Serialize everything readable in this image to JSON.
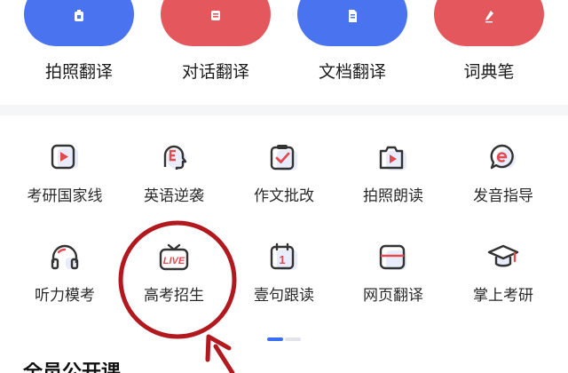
{
  "colors": {
    "blue": "#4a74ef",
    "red": "#e4585d",
    "icon_red": "#e24a4f",
    "annotation": "#b1191f"
  },
  "top_actions": [
    {
      "label": "拍照翻译",
      "color": "blue",
      "icon": "camera-icon"
    },
    {
      "label": "对话翻译",
      "color": "red",
      "icon": "chat-icon"
    },
    {
      "label": "文档翻译",
      "color": "blue",
      "icon": "document-icon"
    },
    {
      "label": "词典笔",
      "color": "red",
      "icon": "pen-icon"
    }
  ],
  "tools_row1": [
    {
      "label": "考研国家线",
      "icon": "video-play-icon"
    },
    {
      "label": "英语逆袭",
      "icon": "head-e-icon"
    },
    {
      "label": "作文批改",
      "icon": "clipboard-check-icon"
    },
    {
      "label": "拍照朗读",
      "icon": "camera-play-icon"
    },
    {
      "label": "发音指导",
      "icon": "speech-bubble-icon"
    }
  ],
  "tools_row2": [
    {
      "label": "听力模考",
      "icon": "headphones-icon"
    },
    {
      "label": "高考招生",
      "icon": "live-tv-icon",
      "badge": "LIVE"
    },
    {
      "label": "壹句跟读",
      "icon": "calendar-one-icon",
      "badge": "1"
    },
    {
      "label": "网页翻译",
      "icon": "browser-window-icon"
    },
    {
      "label": "掌上考研",
      "icon": "graduation-cap-icon"
    }
  ],
  "pager": {
    "active_index": 0,
    "count": 2
  },
  "bottom_section": {
    "title": "全员公开课"
  }
}
